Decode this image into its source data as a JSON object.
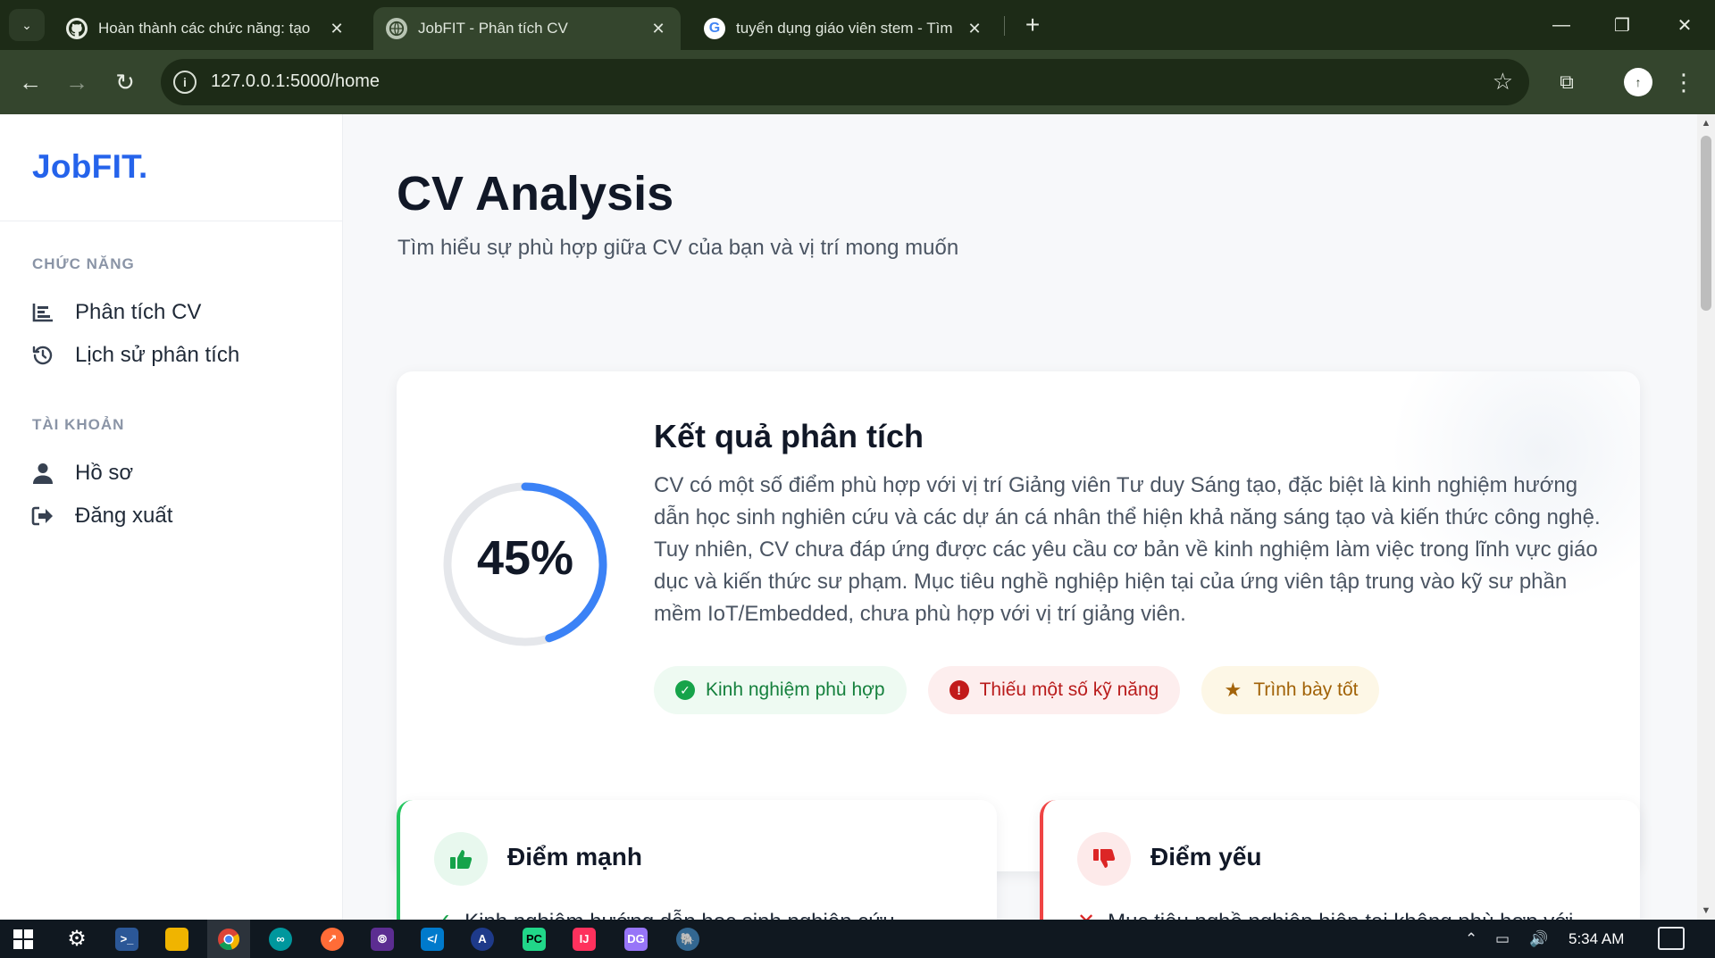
{
  "browser": {
    "tabs": [
      {
        "title": "Hoàn thành các chức năng: tạo",
        "favicon": "github-icon"
      },
      {
        "title": "JobFIT - Phân tích CV",
        "favicon": "globe-icon",
        "active": true
      },
      {
        "title": "tuyển dụng giáo viên stem - Tìm",
        "favicon": "google-icon"
      }
    ],
    "url": "127.0.0.1:5000/home"
  },
  "sidebar": {
    "logo": "JobFIT.",
    "sections": [
      {
        "title": "CHỨC NĂNG",
        "items": [
          {
            "label": "Phân tích CV",
            "icon": "bar-chart-icon"
          },
          {
            "label": "Lịch sử phân tích",
            "icon": "history-icon"
          }
        ]
      },
      {
        "title": "TÀI KHOẢN",
        "items": [
          {
            "label": "Hồ sơ",
            "icon": "user-icon"
          },
          {
            "label": "Đăng xuất",
            "icon": "logout-icon"
          }
        ]
      }
    ]
  },
  "main": {
    "title": "CV Analysis",
    "subtitle": "Tìm hiểu sự phù hợp giữa CV của bạn và vị trí mong muốn",
    "result": {
      "score_percent": 45,
      "score_label": "45%",
      "title": "Kết quả phân tích",
      "summary": "CV có một số điểm phù hợp với vị trí Giảng viên Tư duy Sáng tạo, đặc biệt là kinh nghiệm hướng dẫn học sinh nghiên cứu và các dự án cá nhân thể hiện khả năng sáng tạo và kiến thức công nghệ. Tuy nhiên, CV chưa đáp ứng được các yêu cầu cơ bản về kinh nghiệm làm việc trong lĩnh vực giáo dục và kiến thức sư phạm. Mục tiêu nghề nghiệp hiện tại của ứng viên tập trung vào kỹ sư phần mềm IoT/Embedded, chưa phù hợp với vị trí giảng viên.",
      "tags": [
        {
          "label": "Kinh nghiệm phù hợp",
          "kind": "good",
          "icon": "check-circle-icon"
        },
        {
          "label": "Thiếu một số kỹ năng",
          "kind": "bad",
          "icon": "exclamation-circle-icon"
        },
        {
          "label": "Trình bày tốt",
          "kind": "star",
          "icon": "star-icon"
        }
      ]
    },
    "strengths": {
      "title": "Điểm mạnh",
      "first_item": "Kinh nghiệm hướng dẫn học sinh nghiên cứu"
    },
    "weaknesses": {
      "title": "Điểm yếu",
      "first_item": "Mục tiêu nghề nghiệp hiện tại không phù hợp với"
    }
  },
  "taskbar": {
    "time": "5:34 AM"
  },
  "colors": {
    "brand": "#2563eb",
    "score_arc": "#3b82f6",
    "good": "#16a34a",
    "bad": "#dc2626",
    "star": "#a16207"
  }
}
